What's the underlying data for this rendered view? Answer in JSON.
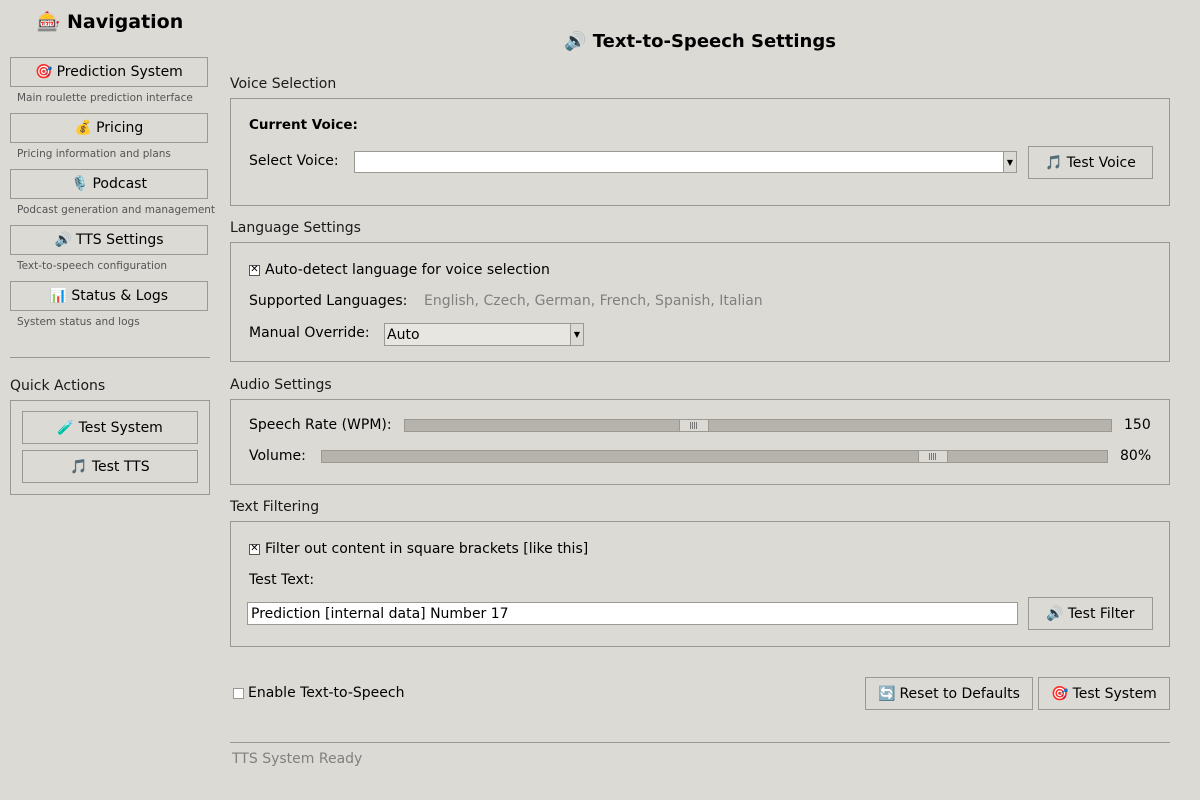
{
  "sidebar": {
    "title": "Navigation",
    "title_icon": "🎰",
    "items": [
      {
        "icon": "🎯",
        "label": "Prediction System",
        "desc": "Main roulette prediction interface"
      },
      {
        "icon": "💰",
        "label": "Pricing",
        "desc": "Pricing information and plans"
      },
      {
        "icon": "🎙️",
        "label": "Podcast",
        "desc": "Podcast generation and management"
      },
      {
        "icon": "🔊",
        "label": "TTS Settings",
        "desc": "Text-to-speech configuration"
      },
      {
        "icon": "📊",
        "label": "Status & Logs",
        "desc": "System status and logs"
      }
    ],
    "quick_actions": {
      "label": "Quick Actions",
      "buttons": [
        {
          "icon": "🧪",
          "label": "Test System"
        },
        {
          "icon": "🎵",
          "label": "Test TTS"
        }
      ]
    }
  },
  "main": {
    "title": "Text-to-Speech Settings",
    "title_icon": "🔊",
    "voice": {
      "section": "Voice Selection",
      "current_label": "Current Voice:",
      "select_label": "Select Voice:",
      "select_value": "",
      "test_icon": "🎵",
      "test_button": "Test Voice"
    },
    "language": {
      "section": "Language Settings",
      "auto_detect_label": "Auto-detect language for voice selection",
      "auto_detect_checked": true,
      "supported_label": "Supported Languages:",
      "supported_value": "English, Czech, German, French, Spanish, Italian",
      "override_label": "Manual Override:",
      "override_value": "Auto"
    },
    "audio": {
      "section": "Audio Settings",
      "rate_label": "Speech Rate (WPM):",
      "rate_value": "150",
      "rate_fraction": 0.405,
      "volume_label": "Volume:",
      "volume_value": "80%",
      "volume_fraction": 0.79
    },
    "filtering": {
      "section": "Text Filtering",
      "filter_label": "Filter out content in square brackets [like this]",
      "filter_checked": true,
      "test_text_label": "Test Text:",
      "test_text_value": "Prediction [internal data] Number 17",
      "filter_icon": "🔊",
      "filter_button": "Test Filter"
    },
    "enable_label": "Enable Text-to-Speech",
    "enable_checked": false,
    "reset_icon": "🔄",
    "reset_button": "Reset to Defaults",
    "test_system_icon": "🎯",
    "test_system_button": "Test System",
    "status_text": "TTS System Ready"
  }
}
